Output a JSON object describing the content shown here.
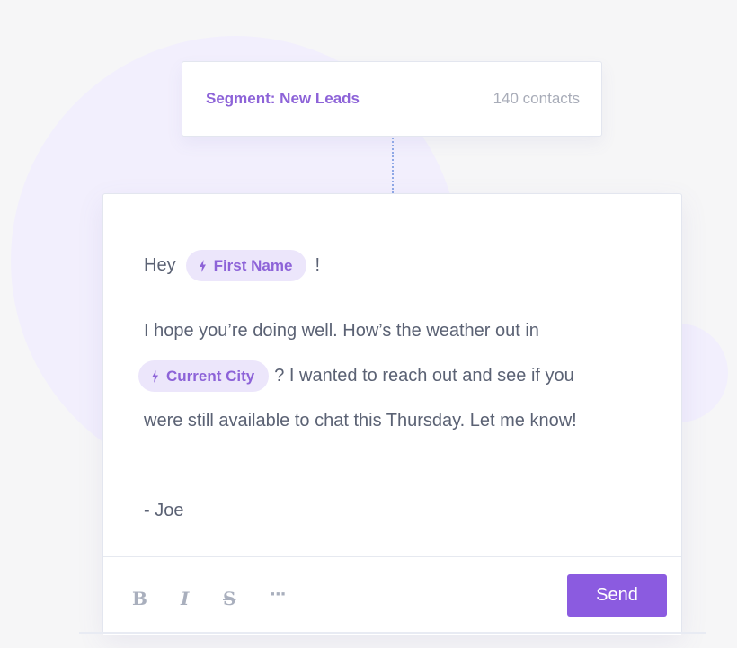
{
  "segment": {
    "label": "Segment: New Leads",
    "count": "140 contacts"
  },
  "email": {
    "greeting_prefix": "Hey",
    "first_name_token": "First Name",
    "greeting_suffix": "!",
    "line2": "I hope you’re doing well. How’s the weather out in",
    "city_token": "Current City",
    "line3_rest": "? I wanted to reach out and see if you",
    "line4": "were still available to chat this Thursday. Let me know!",
    "signature": "- Joe"
  },
  "toolbar": {
    "bold": "B",
    "italic": "I",
    "strike": "S",
    "more": "···",
    "send": "Send"
  },
  "icons": {
    "token_icon": "bolt-icon"
  },
  "colors": {
    "accent": "#8b5be0",
    "token_bg": "#ece6fb",
    "token_text": "#8d63d8",
    "body_text": "#5b6274",
    "muted": "#a8acb8"
  }
}
